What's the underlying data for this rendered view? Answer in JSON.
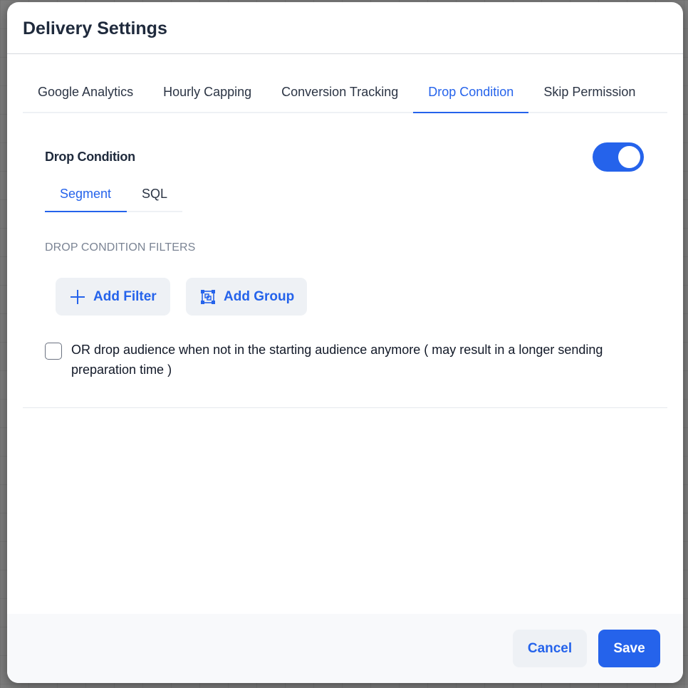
{
  "modal": {
    "title": "Delivery Settings"
  },
  "tabs": [
    {
      "label": "Google Analytics",
      "active": false
    },
    {
      "label": "Hourly Capping",
      "active": false
    },
    {
      "label": "Conversion Tracking",
      "active": false
    },
    {
      "label": "Drop Condition",
      "active": true
    },
    {
      "label": "Skip Permission",
      "active": false
    }
  ],
  "drop_condition": {
    "title": "Drop Condition",
    "toggle_on": true,
    "subtabs": [
      {
        "label": "Segment",
        "active": true
      },
      {
        "label": "SQL",
        "active": false
      }
    ],
    "filters_label": "DROP CONDITION FILTERS",
    "add_filter_label": "Add Filter",
    "add_filter_icon": "plus-icon",
    "add_group_label": "Add Group",
    "add_group_icon": "group-icon",
    "checkbox_checked": false,
    "checkbox_label": "OR drop audience when not in the starting audience anymore ( may result in a longer sending preparation time )"
  },
  "footer": {
    "cancel_label": "Cancel",
    "save_label": "Save"
  },
  "colors": {
    "accent": "#2563eb",
    "title_text": "#1f2a3c",
    "muted_text": "#7b8494",
    "button_light_bg": "#eef1f5",
    "footer_bg": "#f8f9fb"
  }
}
